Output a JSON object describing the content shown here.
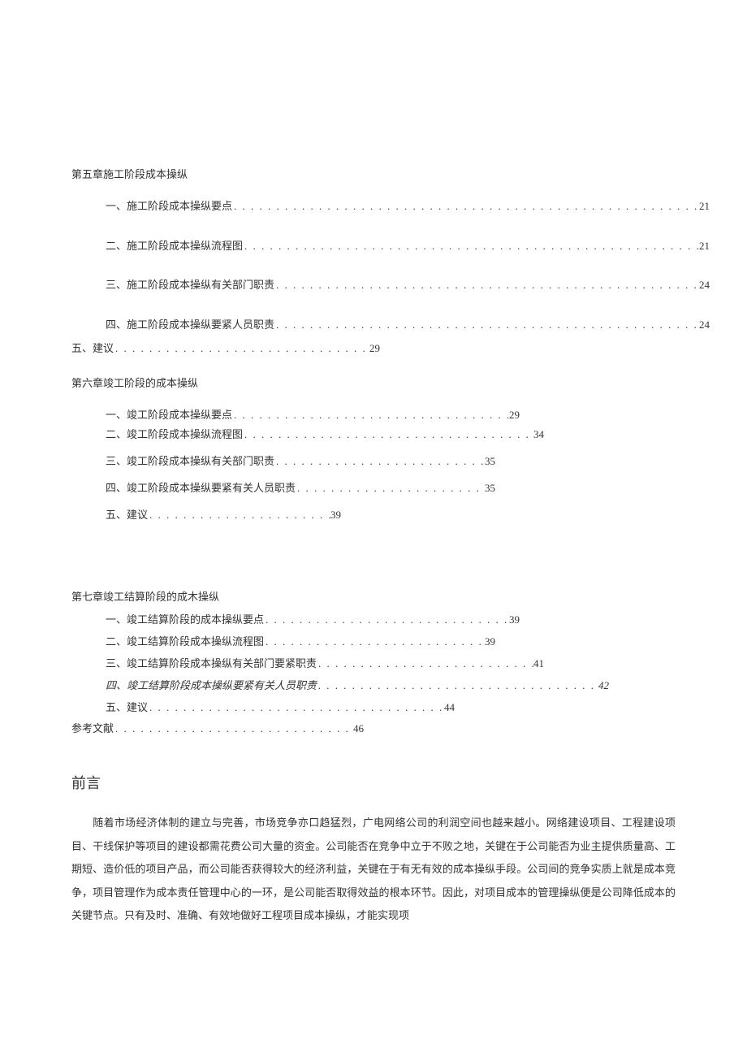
{
  "chapter5": {
    "title": "第五章施工阶段成本操纵",
    "items": [
      {
        "label": "一、施工阶段成本操纵要点",
        "page": "21"
      },
      {
        "label": "二、施工阶段成本操纵流程图",
        "page": "21"
      },
      {
        "label": "三、施工阶段成本操纵有关部门职责",
        "page": "24"
      },
      {
        "label": "四、施工阶段成本操纵要紧人员职责",
        "page": "24"
      }
    ],
    "item5": {
      "label": "五、建议",
      "page": "29"
    }
  },
  "chapter6": {
    "title": "第六章竣工阶段的成本操纵",
    "items": [
      {
        "label": "一、竣工阶段成本操纵要点",
        "page": "29"
      },
      {
        "label": "二、竣工阶段成本操纵流程图",
        "page": "34"
      },
      {
        "label": "三、竣工阶段成本操纵有关部门职责",
        "page": "35"
      },
      {
        "label": "四、竣工阶段成本操纵要紧有关人员职责",
        "page": "35"
      },
      {
        "label": "五、建议",
        "page": "39"
      }
    ]
  },
  "chapter7": {
    "title": "第七章竣工结算阶段的成木操纵",
    "items": [
      {
        "label": "一、竣工结算阶段的成本操纵要点",
        "page": "39"
      },
      {
        "label": "二、竣工结算阶段成本操纵流程图",
        "page": "39"
      },
      {
        "label": "三、竣工结算阶段成本操纵有关部门要紧职责",
        "page": "41"
      },
      {
        "label": "四、竣工结算阶段成本操纵要紧有关人员职责",
        "page": "42"
      },
      {
        "label": "五、建议",
        "page": "44"
      }
    ]
  },
  "references": {
    "label": "参考文献",
    "page": "46"
  },
  "preface": {
    "title": "前言",
    "body": "随着市场经济体制的建立与完善，市场竞争亦口趋猛烈，广电网络公司的利润空间也越来越小。网络建设项目、工程建设项目、干线保护等项目的建设都需花费公司大量的资金。公司能否在竞争中立于不败之地，关键在于公司能否为业主提供质量高、工期短、造价低的项目产品，而公司能否获得较大的经济利益，关键在于有无有效的成本操纵手段。公司间的竞争实质上就是成本竞争，项目管理作为成本责任管理中心的一环，是公司能否取得效益的根本环节。因此，对项目成本的管理操纵便是公司降低成本的关键节点。只有及时、准确、有效地做好工程项目成本操纵，才能实现项"
  }
}
